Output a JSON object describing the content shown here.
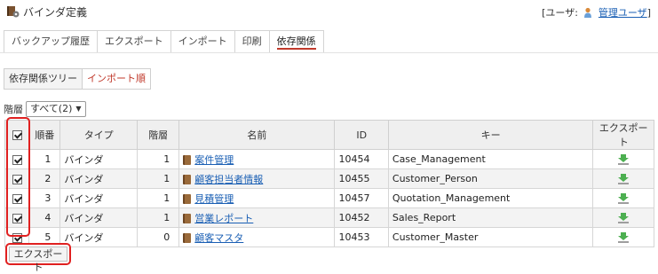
{
  "header": {
    "title": "バインダ定義",
    "user_prefix": "[ユーザ:",
    "user_name": "管理ユーザ",
    "user_suffix": "]"
  },
  "tabs": [
    {
      "label": "バックアップ履歴"
    },
    {
      "label": "エクスポート"
    },
    {
      "label": "インポート"
    },
    {
      "label": "印刷"
    },
    {
      "label": "依存関係",
      "active": true
    }
  ],
  "subtabs": [
    {
      "label": "依存関係ツリー"
    },
    {
      "label": "インポート順",
      "active": true
    }
  ],
  "filter": {
    "label": "階層",
    "value": "すべて(2)"
  },
  "table": {
    "columns": [
      "順番",
      "タイプ",
      "階層",
      "名前",
      "ID",
      "キー",
      "エクスポート"
    ],
    "rows": [
      {
        "no": "1",
        "type": "バインダ",
        "level": "1",
        "name": "案件管理",
        "id": "10454",
        "key": "Case_Management",
        "checked": true
      },
      {
        "no": "2",
        "type": "バインダ",
        "level": "1",
        "name": "顧客担当者情報",
        "id": "10455",
        "key": "Customer_Person",
        "checked": true
      },
      {
        "no": "3",
        "type": "バインダ",
        "level": "1",
        "name": "見積管理",
        "id": "10457",
        "key": "Quotation_Management",
        "checked": true
      },
      {
        "no": "4",
        "type": "バインダ",
        "level": "1",
        "name": "営業レポート",
        "id": "10452",
        "key": "Sales_Report",
        "checked": true
      },
      {
        "no": "5",
        "type": "バインダ",
        "level": "0",
        "name": "顧客マスタ",
        "id": "10453",
        "key": "Customer_Master",
        "checked": true
      }
    ]
  },
  "footer": {
    "export_label": "エクスポート"
  },
  "colors": {
    "accent": "#c0392b",
    "highlight": "#e02020",
    "link": "#1a5fb4"
  }
}
